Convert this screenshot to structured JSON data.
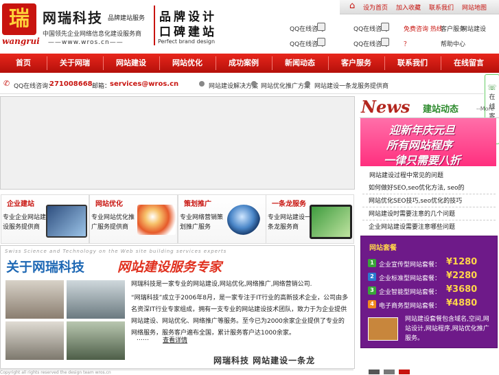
{
  "header": {
    "logo_char": "瑞",
    "logo_sub": "wangrui",
    "brand_name": "网瑞科技",
    "brand_tag": "品牌建站服务",
    "brand_desc": "中国领先企业网络信息化建设服务商",
    "brand_site": "——www.wros.cn——",
    "slogan_1": "品牌设计",
    "slogan_2": "口碑建站",
    "slogan_3": "Perfect brand design"
  },
  "toplinks": [
    "设为首页",
    "加入收藏",
    "联系我们",
    "网站地图"
  ],
  "qq": {
    "items": [
      "QQ在线咨询",
      "QQ在线咨询",
      "QQ在线咨询",
      "QQ在线咨询"
    ],
    "red_link_1": "免费咨询 热线",
    "red_link_2": "？",
    "plain_links": [
      "客户服务",
      "网站建设",
      "帮助中心",
      "在线留言"
    ]
  },
  "nav": [
    "首页",
    "关于网瑞",
    "网站建设",
    "网站优化",
    "成功案例",
    "新闻动态",
    "客户服务",
    "联系我们",
    "在线留言"
  ],
  "contact": {
    "qq_label": "QQ在线咨询：",
    "qq_number": "271008668",
    "mail_label": "邮箱：",
    "mail": "services@wros.cn",
    "links": [
      "网站建设解决方案",
      "网站优化推广方案",
      "网站建设一条龙服务提供商"
    ]
  },
  "online_tab": [
    "在",
    "线",
    "客",
    "服"
  ],
  "services": [
    {
      "title": "企业建站",
      "text": "专业企业网站建设服务提供商"
    },
    {
      "title": "网站优化",
      "text": "专业网站优化推广服务提供商"
    },
    {
      "title": "策划推广",
      "text": "专业网络营销策划推广服务"
    },
    {
      "title": "一条龙服务",
      "text": "专业网站建设一条龙服务商"
    }
  ],
  "about": {
    "en": "Swiss Science and Technology on the Web site building services experts",
    "title_1": "关于网瑞科技",
    "title_2": "网站建设服务专家",
    "p1": "网瑞科技是一家专业的网站建设,网站优化,网络推广,网络营销公司.",
    "p2": "“网瑞科技”成立于2006年8月，是一家专注于IT行业的高新技术企业，公司由多名资深IT行业专家组成，拥有一支专业的网站建设技术团队，致力于为企业提供网站建设、网站优化、网络推广等服务。至今已为2000余家企业提供了专业的网络服务，服务客户遍布全国，累计服务客户达1000余家。",
    "dots": "……",
    "more": "查看详情",
    "slogan": "网瑞科技  网站建设一条龙"
  },
  "bottom_strip": "Copyright all rights reserved the design team wros.cn",
  "news": {
    "word": "News",
    "cn": "建站动态",
    "more": "--More",
    "promo": [
      "迎新年庆元旦",
      "所有网站程序",
      "一律只需要八折"
    ],
    "list_title": "网站建设过程中常见的问题",
    "items": [
      "如何做好SEO,seo优化方法, seo的",
      "网站优化SEO技巧,seo优化的技巧",
      "网站建设时需要注意的几个问题",
      "企业网站建设需要注意哪些问题"
    ]
  },
  "packages": {
    "title": "网站套餐",
    "items": [
      {
        "num": "1",
        "name": "企业宣传型网站套餐：",
        "price": "¥1280",
        "color": "#3aa63a"
      },
      {
        "num": "2",
        "name": "企业标准型网站套餐：",
        "price": "¥2280",
        "color": "#2a7ad0"
      },
      {
        "num": "3",
        "name": "企业智能型网站套餐：",
        "price": "¥3680",
        "color": "#3aa63a"
      },
      {
        "num": "4",
        "name": "电子商务型网站套餐：",
        "price": "¥4880",
        "color": "#f08a1e"
      }
    ],
    "desc": "网站建设套餐包含域名,空间,网站设计,网站程序,网站优化推广服务。"
  },
  "colors": {
    "brand_red": "#c8140f",
    "nav_red": "#e8261c",
    "purple": "#6e1a89"
  }
}
